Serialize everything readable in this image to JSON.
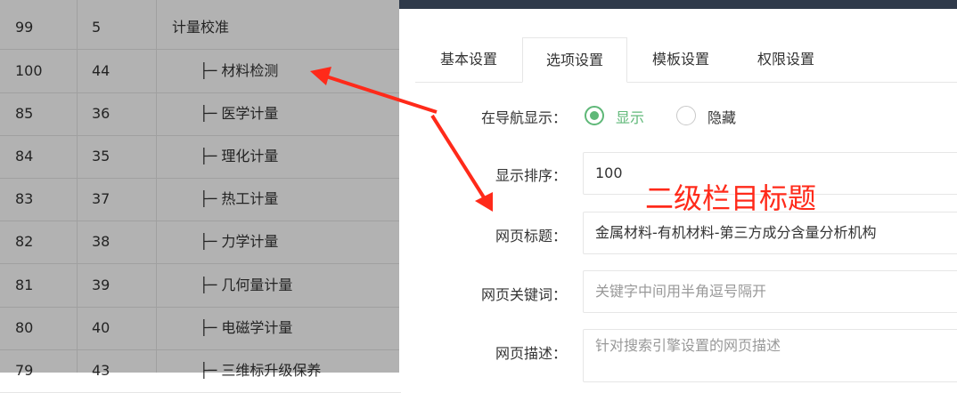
{
  "table": {
    "rows": [
      {
        "c1": "99",
        "c2": "5",
        "c3": "计量校准"
      },
      {
        "c1": "100",
        "c2": "44",
        "c3": "├─ 材料检测"
      },
      {
        "c1": "85",
        "c2": "36",
        "c3": "├─ 医学计量"
      },
      {
        "c1": "84",
        "c2": "35",
        "c3": "├─ 理化计量"
      },
      {
        "c1": "83",
        "c2": "37",
        "c3": "├─ 热工计量"
      },
      {
        "c1": "82",
        "c2": "38",
        "c3": "├─ 力学计量"
      },
      {
        "c1": "81",
        "c2": "39",
        "c3": "├─ 几何量计量"
      },
      {
        "c1": "80",
        "c2": "40",
        "c3": "├─ 电磁学计量"
      },
      {
        "c1": "79",
        "c2": "43",
        "c3": "├─ 三维标升级保养"
      }
    ]
  },
  "tabs": [
    "基本设置",
    "选项设置",
    "模板设置",
    "权限设置"
  ],
  "form": {
    "nav_label": "在导航显示：",
    "radio_show": "显示",
    "radio_hide": "隐藏",
    "sort_label": "显示排序：",
    "sort_value": "100",
    "title_label": "网页标题：",
    "title_value": "金属材料-有机材料-第三方成分含量分析机构",
    "keywords_label": "网页关键词：",
    "keywords_placeholder": "关键字中间用半角逗号隔开",
    "desc_label": "网页描述：",
    "desc_placeholder": "针对搜索引擎设置的网页描述"
  },
  "annotation": "二级栏目标题",
  "colors": {
    "accent": "#5fb878",
    "annotation": "#ff2a1a",
    "header": "#2f3a4a"
  }
}
